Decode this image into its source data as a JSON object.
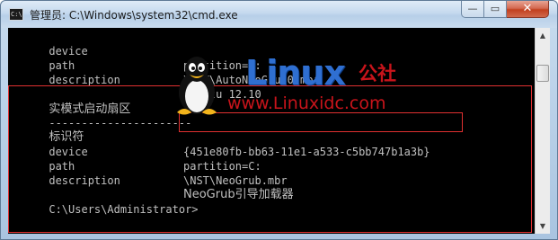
{
  "window": {
    "title": "管理员: C:\\Windows\\system32\\cmd.exe",
    "app_icon_text": "C:\\"
  },
  "caption": {
    "minimize_glyph": "—",
    "maximize_glyph": "▭",
    "close_glyph": "✕"
  },
  "console": {
    "lines": [
      {
        "key": "device",
        "value": "partition=C:"
      },
      {
        "key": "path",
        "value": "\\NST\\AutoNeoGrub0.mbr"
      },
      {
        "key": "description",
        "value": "Ubuntu 12.10"
      },
      {
        "key": "实模式启动扇区",
        "value": ""
      },
      {
        "key": "----------------------",
        "value": ""
      },
      {
        "key": "标识符",
        "value": "{451e80fb-bb63-11e1-a533-c5bb747b1a3b}"
      },
      {
        "key": "device",
        "value": "partition=C:"
      },
      {
        "key": "path",
        "value": "\\NST\\NeoGrub.mbr"
      },
      {
        "key": "description",
        "value": "NeoGrub引导加载器"
      },
      {
        "key": "",
        "value": ""
      },
      {
        "key": "C:\\Users\\Administrator>",
        "value": ""
      }
    ]
  },
  "watermark": {
    "brand": "Linux",
    "brand_suffix": "公社",
    "url": "www.Linuxidc.com"
  },
  "scrollbar": {
    "up_glyph": "▲",
    "down_glyph": "▼"
  }
}
